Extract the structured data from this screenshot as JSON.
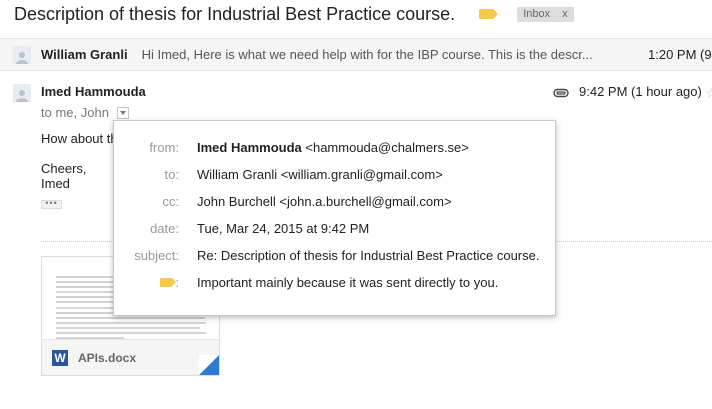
{
  "subject": {
    "title": "Description of thesis for Industrial Best Practice course.",
    "label_icon": "label-tag-icon",
    "label_color": "#f7c948",
    "inbox_chip": "Inbox",
    "inbox_remove": "x"
  },
  "collapsed_message": {
    "sender": "William Granli",
    "snippet": "Hi Imed, Here is what we need help with for the IBP course. This is the descr...",
    "time": "1:20 PM (9"
  },
  "expanded_message": {
    "sender": "Imed Hammouda",
    "to_line": "to me, John",
    "time": "9:42 PM (1 hour ago)",
    "body_start": "How about th",
    "closing": "Cheers,",
    "signature": "Imed",
    "ellipsis": "•••"
  },
  "attachment": {
    "filename": "APIs.docx",
    "type_glyph": "W",
    "type_color": "#2a5699"
  },
  "details": {
    "from_label": "from:",
    "from_name": "Imed Hammouda",
    "from_email": "<hammouda@chalmers.se>",
    "to_label": "to:",
    "to_value": "William Granli <william.granli@gmail.com>",
    "cc_label": "cc:",
    "cc_value": "John Burchell <john.a.burchell@gmail.com>",
    "date_label": "date:",
    "date_value": "Tue, Mar 24, 2015 at 9:42 PM",
    "subject_label": "subject:",
    "subject_value": "Re: Description of thesis for Industrial Best Practice course.",
    "importance_colon": ":",
    "importance_value": "Important mainly because it was sent directly to you."
  }
}
